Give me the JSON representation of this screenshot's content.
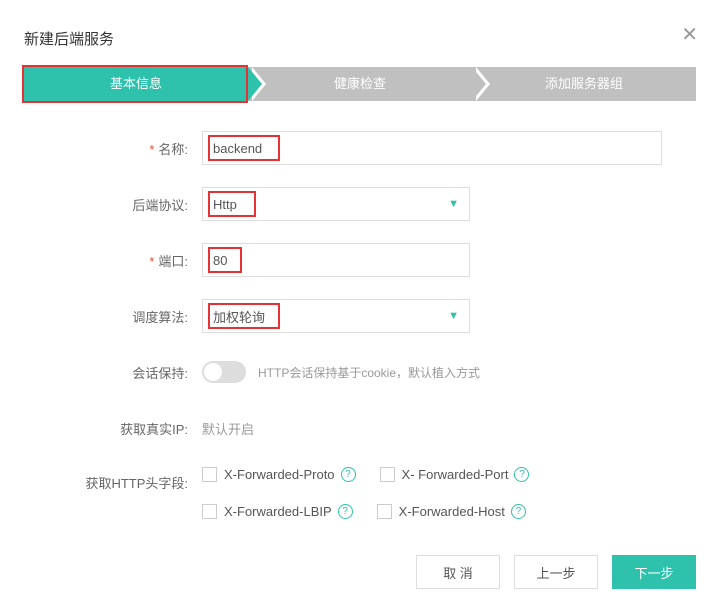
{
  "dialog": {
    "title": "新建后端服务"
  },
  "steps": {
    "items": [
      {
        "label": "基本信息"
      },
      {
        "label": "健康检查"
      },
      {
        "label": "添加服务器组"
      }
    ]
  },
  "form": {
    "name": {
      "label": "名称:",
      "value": "backend"
    },
    "protocol": {
      "label": "后端协议:",
      "value": "Http"
    },
    "port": {
      "label": "端口:",
      "value": "80"
    },
    "algorithm": {
      "label": "调度算法:",
      "value": "加权轮询"
    },
    "session": {
      "label": "会话保持:",
      "hint": "HTTP会话保持基于cookie，默认植入方式",
      "on": false
    },
    "real_ip": {
      "label": "获取真实IP:",
      "value": "默认开启"
    },
    "http_headers": {
      "label": "获取HTTP头字段:",
      "options": [
        {
          "label": "X-Forwarded-Proto"
        },
        {
          "label": "X- Forwarded-Port"
        },
        {
          "label": "X-Forwarded-LBIP"
        },
        {
          "label": "X-Forwarded-Host"
        }
      ]
    }
  },
  "footer": {
    "cancel": "取 消",
    "prev": "上一步",
    "next": "下一步"
  }
}
